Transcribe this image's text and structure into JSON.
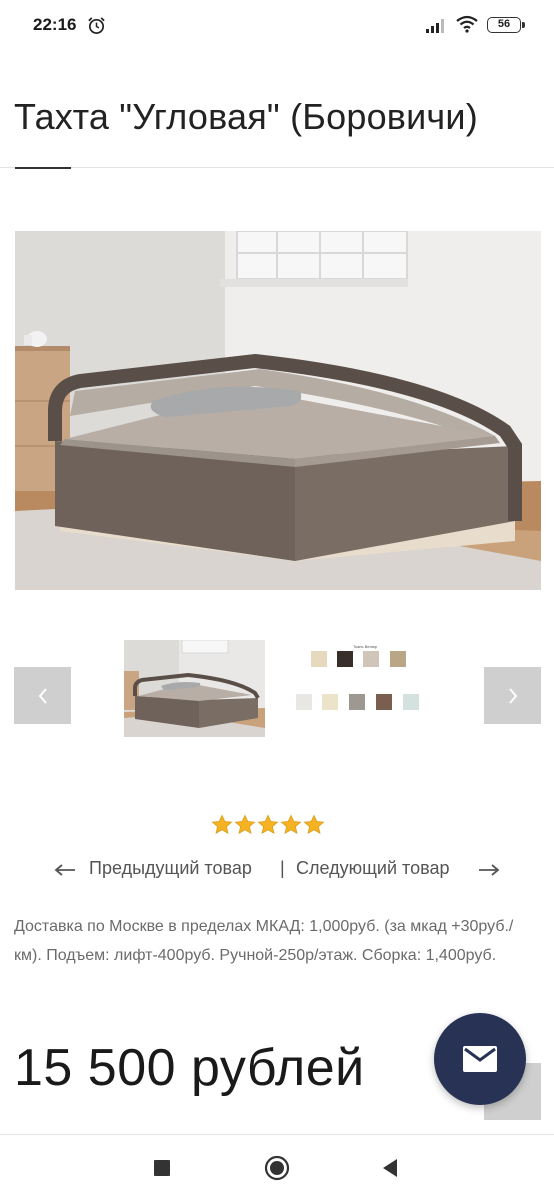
{
  "status_bar": {
    "time": "22:16",
    "battery": "56"
  },
  "product": {
    "title": "Тахта \"Угловая\" (Боровичи)",
    "rating_stars": 5,
    "rating_max": 5
  },
  "gallery": {
    "swatch_card_title": "Ткань Велюр"
  },
  "product_nav": {
    "prev_label": "Предыдущий товар",
    "separator": "|",
    "next_label": "Следующий товар"
  },
  "delivery": {
    "text": "Доставка по Москве в пределах МКАД: 1,000руб. (за мкад +30руб./км). Подъем: лифт-400руб. Ручной-250р/этаж. Сборка: 1,400руб."
  },
  "price": {
    "text": "15 500 рублей"
  },
  "colors": {
    "accent": "#283255",
    "star": "#f5b323",
    "button_grey": "#cfcfcf"
  }
}
